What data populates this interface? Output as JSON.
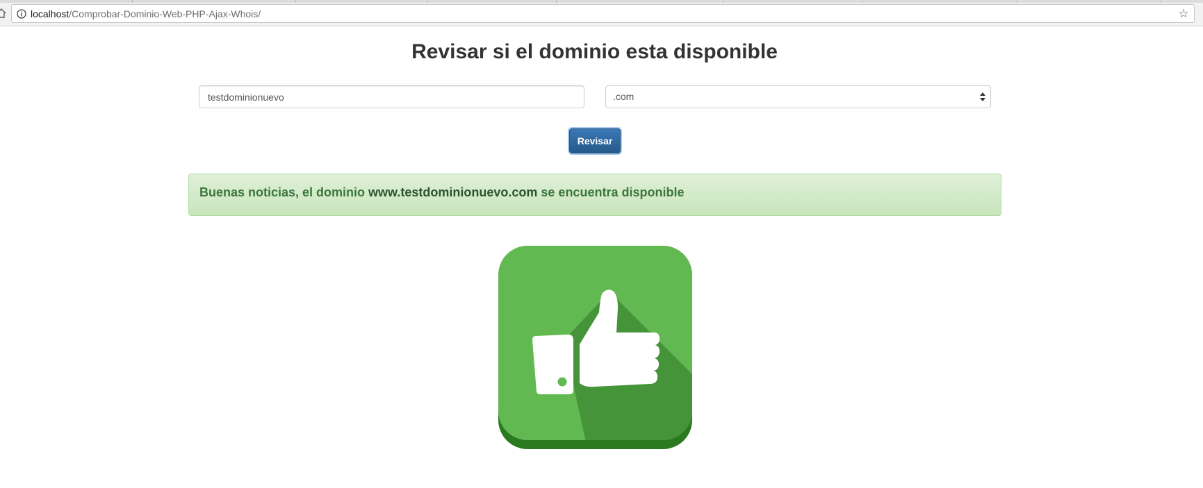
{
  "browser": {
    "url_host": "localhost",
    "url_path": "/Comprobar-Dominio-Web-PHP-Ajax-Whois/"
  },
  "page": {
    "title": "Revisar si el dominio esta disponible"
  },
  "form": {
    "domain_value": "testdominionuevo",
    "tld_selected": ".com",
    "submit_label": "Revisar"
  },
  "result": {
    "prefix": "Buenas noticias, el dominio ",
    "domain": "www.testdominionuevo.com",
    "suffix": " se encuentra disponible",
    "status": "success",
    "icon": "thumbs-up-icon"
  },
  "colors": {
    "button": "#265a88",
    "alert_text": "#3c763d",
    "alert_bg": "#dff0d8",
    "icon_green": "#63b951"
  }
}
